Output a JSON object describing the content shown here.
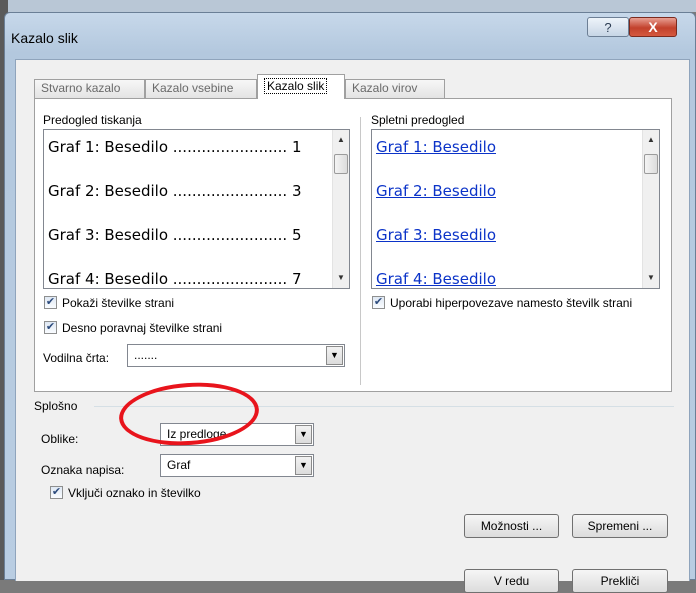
{
  "window": {
    "title": "Kazalo slik",
    "help_label": "?",
    "close_label": "X"
  },
  "tabs": [
    {
      "label": "Stvarno kazalo"
    },
    {
      "label": "Kazalo vsebine"
    },
    {
      "label": "Kazalo slik"
    },
    {
      "label": "Kazalo virov"
    }
  ],
  "print_preview": {
    "label": "Predogled tiskanja",
    "entries": [
      {
        "text": "Graf 1: Besedilo ........................ 1"
      },
      {
        "text": "Graf 2: Besedilo ........................ 3"
      },
      {
        "text": "Graf 3: Besedilo ........................ 5"
      },
      {
        "text": "Graf 4: Besedilo ........................ 7"
      }
    ]
  },
  "web_preview": {
    "label": "Spletni predogled",
    "entries": [
      {
        "text": "Graf 1: Besedilo"
      },
      {
        "text": "Graf 2: Besedilo"
      },
      {
        "text": "Graf 3: Besedilo"
      },
      {
        "text": "Graf 4: Besedilo"
      }
    ]
  },
  "options": {
    "show_page_numbers": "Pokaži številke strani",
    "right_align": "Desno poravnaj številke strani",
    "use_hyperlinks": "Uporabi hiperpovezave namesto številk strani",
    "tab_leader_label": "Vodilna črta:",
    "tab_leader_value": "......."
  },
  "general": {
    "label": "Splošno",
    "formats_label": "Oblike:",
    "formats_value": "Iz predloge",
    "caption_label": "Oznaka napisa:",
    "caption_value": "Graf",
    "include_label": "Vključi oznako in številko"
  },
  "buttons": {
    "options": "Možnosti ...",
    "modify": "Spremeni ...",
    "ok": "V redu",
    "cancel": "Prekliči"
  },
  "colors": {
    "link": "#0b33c8",
    "highlight": "#e8141c"
  }
}
